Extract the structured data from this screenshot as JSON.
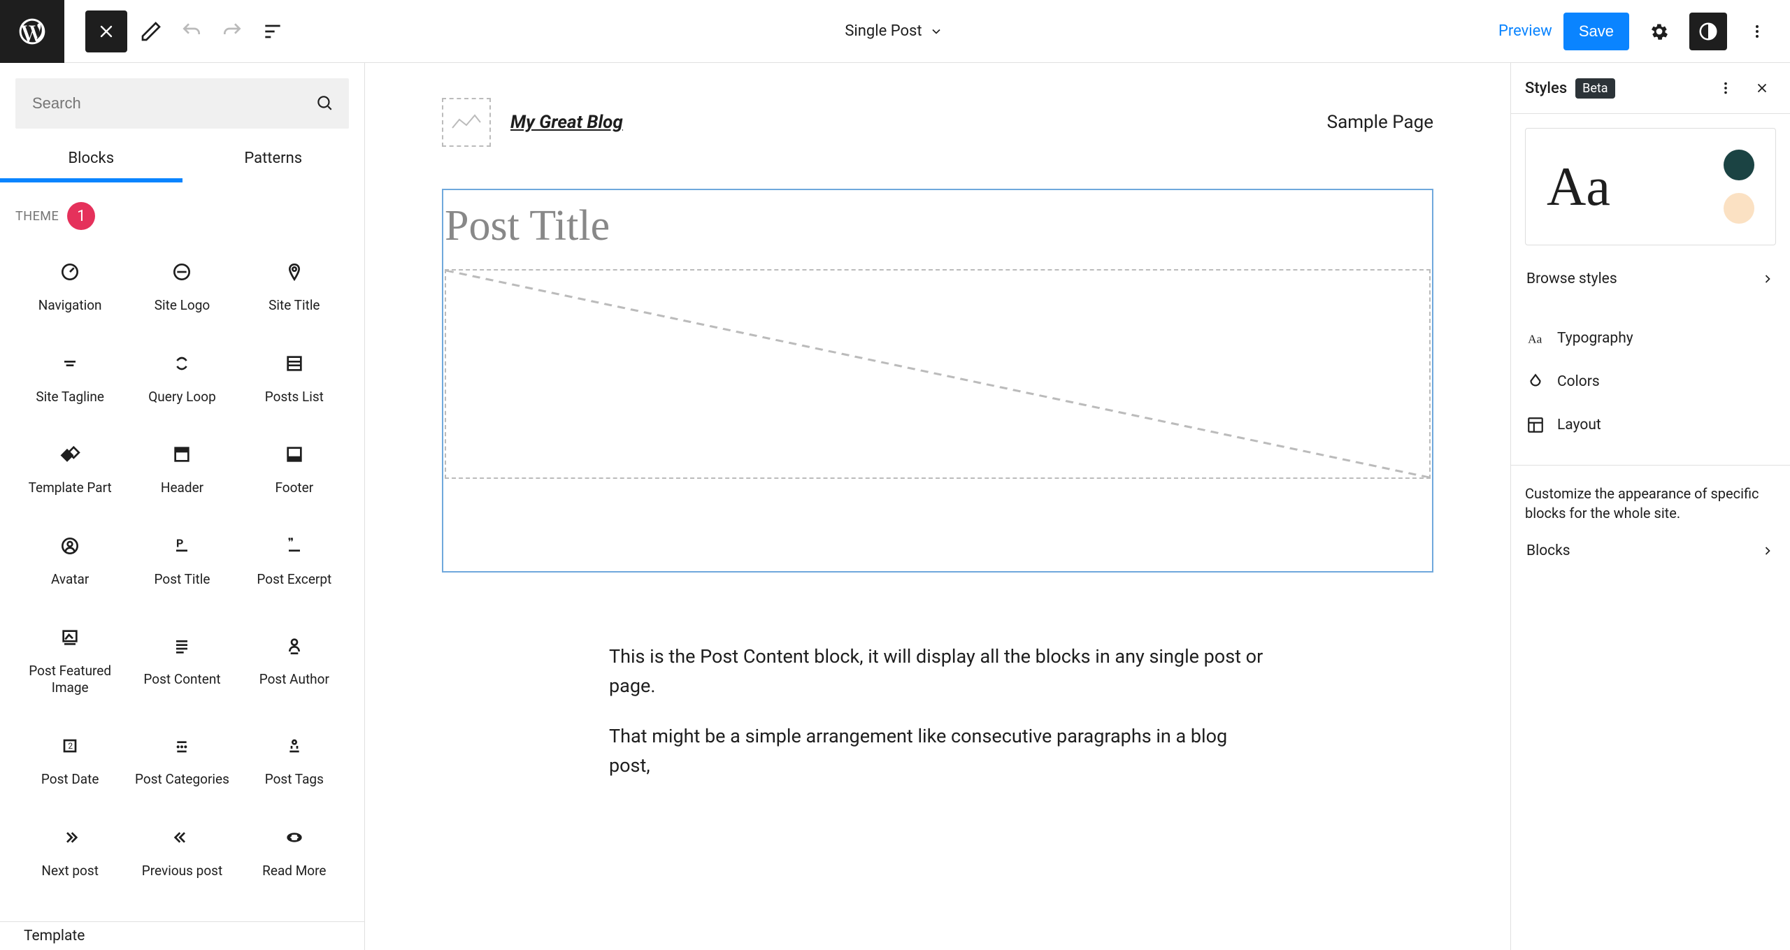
{
  "topbar": {
    "document_title": "Single Post",
    "preview": "Preview",
    "save": "Save"
  },
  "left_panel": {
    "search_placeholder": "Search",
    "tabs": {
      "blocks": "Blocks",
      "patterns": "Patterns"
    },
    "section_title": "THEME",
    "badge": "1",
    "blocks": [
      {
        "label": "Navigation"
      },
      {
        "label": "Site Logo"
      },
      {
        "label": "Site Title"
      },
      {
        "label": "Site Tagline"
      },
      {
        "label": "Query Loop"
      },
      {
        "label": "Posts List"
      },
      {
        "label": "Template Part"
      },
      {
        "label": "Header"
      },
      {
        "label": "Footer"
      },
      {
        "label": "Avatar"
      },
      {
        "label": "Post Title"
      },
      {
        "label": "Post Excerpt"
      },
      {
        "label": "Post Featured Image"
      },
      {
        "label": "Post Content"
      },
      {
        "label": "Post Author"
      },
      {
        "label": "Post Date"
      },
      {
        "label": "Post Categories"
      },
      {
        "label": "Post Tags"
      },
      {
        "label": "Next post"
      },
      {
        "label": "Previous post"
      },
      {
        "label": "Read More"
      }
    ]
  },
  "canvas": {
    "site_title": "My Great Blog",
    "nav_link": "Sample Page",
    "post_title_placeholder": "Post Title",
    "content_p1": "This is the Post Content block, it will display all the blocks in any single post or page.",
    "content_p2": "That might be a simple arrangement like consecutive paragraphs in a blog post,"
  },
  "right_panel": {
    "title": "Styles",
    "beta": "Beta",
    "preview_text": "Aa",
    "colors": {
      "dark": "#1b4343",
      "light": "#fbe1c3"
    },
    "browse": "Browse styles",
    "typography": "Typography",
    "colors_label": "Colors",
    "layout": "Layout",
    "desc": "Customize the appearance of specific blocks for the whole site.",
    "blocks_link": "Blocks"
  },
  "status": "Template"
}
